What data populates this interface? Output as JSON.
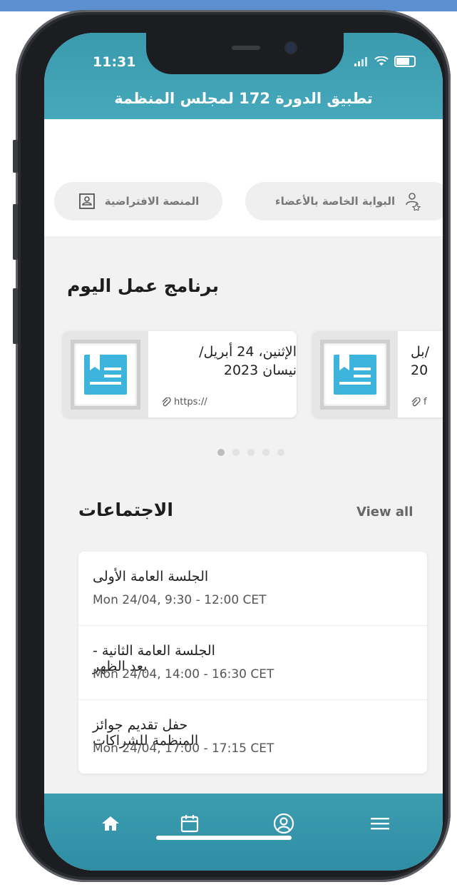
{
  "status_bar": {
    "time": "11:31"
  },
  "app": {
    "title": "تطبيق الدورة 172 لمجلس المنظمة"
  },
  "portals": {
    "members_portal": "البوابة الخاصة بالأعضاء",
    "virtual_platform": "المنصة الافتراضية"
  },
  "daily_program": {
    "title": "برنامج عمل اليوم",
    "cards": [
      {
        "date": "الإثنين، 24 أبريل/ نيسان 2023",
        "link": "https://"
      },
      {
        "date_partial": "بل/",
        "year_partial": "20",
        "link_partial": "f"
      }
    ],
    "pager": {
      "count": 5,
      "active": 0
    }
  },
  "meetings": {
    "title": "الاجتماعات",
    "view_all": "View all",
    "items": [
      {
        "title": "الجلسة العامة الأولى",
        "time": "Mon 24/04, 9:30 - 12:00 CET"
      },
      {
        "title": "الجلسة العامة الثانية - بعد الظهر",
        "time": "Mon 24/04, 14:00 - 16:30 CET"
      },
      {
        "title": "حفل تقديم جوائز المنظمة للشراكات",
        "time": "Mon 24/04, 17:00 - 17:15 CET"
      }
    ]
  },
  "nav": {
    "items": [
      "home-icon",
      "calendar-icon",
      "profile-icon",
      "menu-icon"
    ]
  },
  "colors": {
    "primary": "#3a9aae",
    "nav": "#2f8ea4",
    "doc_icon": "#3db4dc"
  }
}
